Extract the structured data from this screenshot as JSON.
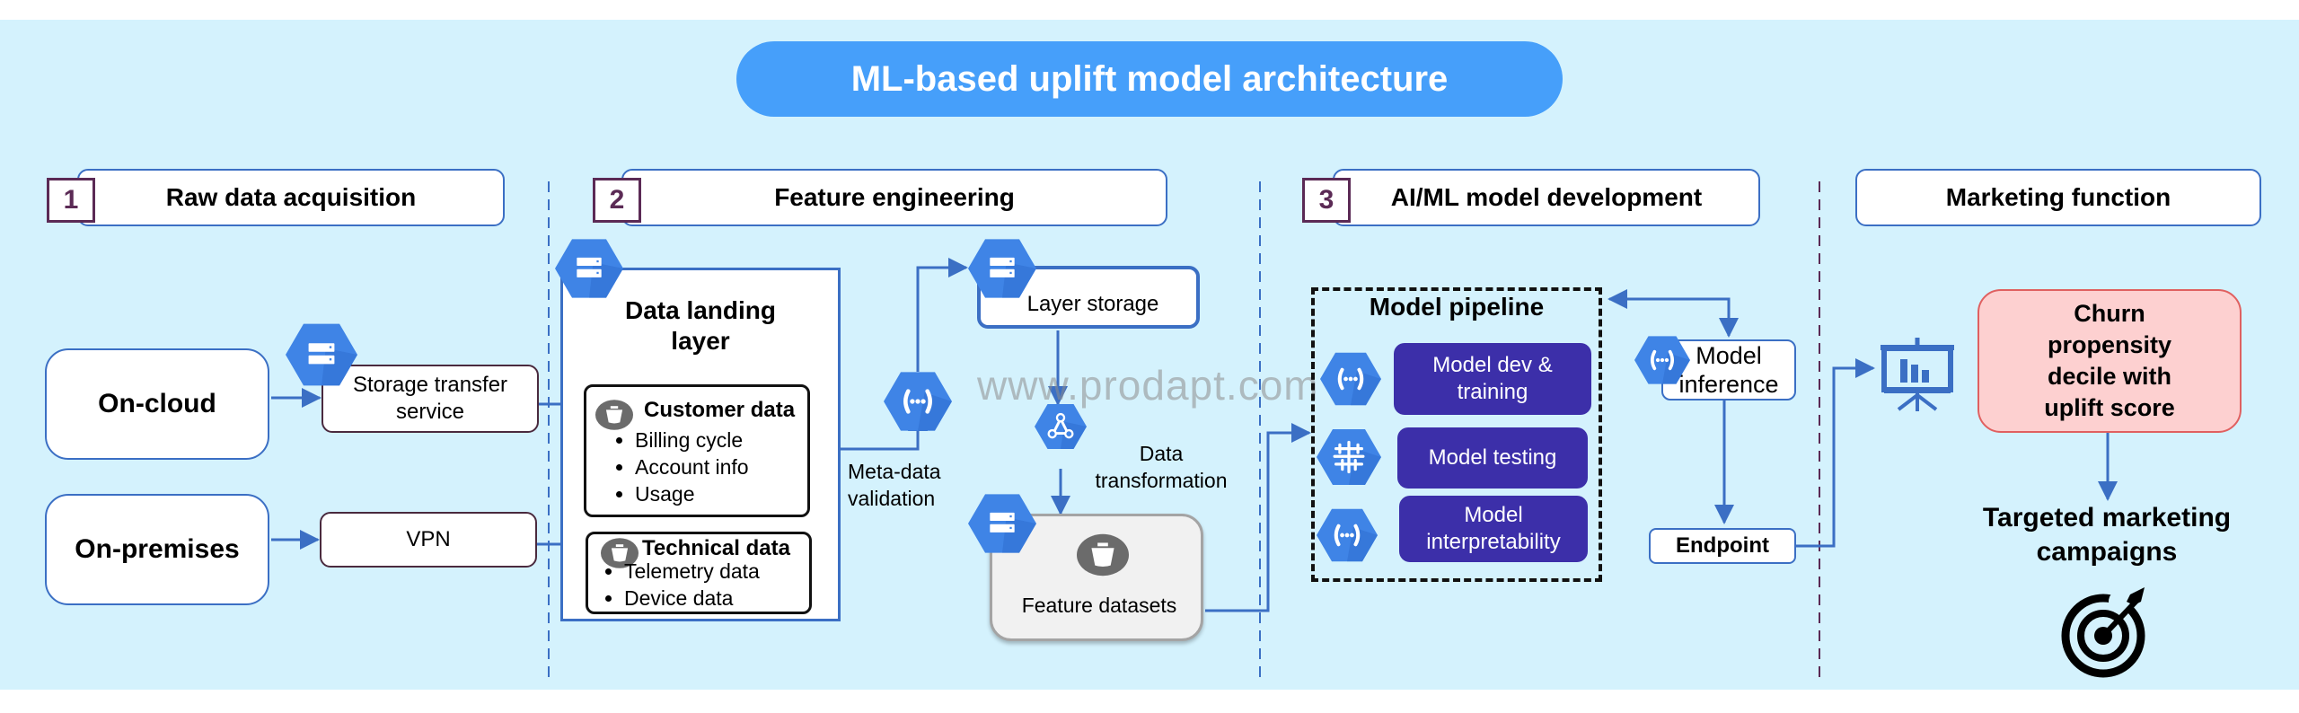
{
  "title": "ML-based uplift model architecture",
  "watermark": "www.prodapt.com",
  "colors": {
    "background": "#d4f2fd",
    "title_pill": "#469ffa",
    "connector_blue": "#3b6fc4",
    "badge_border": "#5b2a55",
    "hex_icon": "#3f84e6",
    "pipeline_step": "#3c2fa9",
    "churn_fill": "#fdd0d0",
    "churn_border": "#e06060"
  },
  "sections": [
    {
      "number": "1",
      "label": "Raw data acquisition"
    },
    {
      "number": "2",
      "label": "Feature engineering"
    },
    {
      "number": "3",
      "label": "AI/ML model development"
    },
    {
      "number": "",
      "label": "Marketing function"
    }
  ],
  "raw_data": {
    "sources": [
      {
        "label": "On-cloud",
        "icon": "cloud-storage-icon"
      },
      {
        "label": "On-premises"
      }
    ],
    "services": [
      {
        "label_line1": "Storage transfer",
        "label_line2": "service",
        "icon": "cloud-storage-icon"
      },
      {
        "label_line1": "VPN",
        "label_line2": ""
      }
    ]
  },
  "feature_engineering": {
    "landing_layer": {
      "title_line1": "Data landing",
      "title_line2": "layer",
      "icon": "cloud-storage-icon",
      "cards": [
        {
          "title": "Customer data",
          "icon": "basket-icon",
          "items": [
            "Billing cycle",
            "Account info",
            "Usage"
          ]
        },
        {
          "title": "Technical data",
          "icon": "basket-icon",
          "items": [
            "Telemetry data",
            "Device data"
          ]
        }
      ]
    },
    "metadata_validation": {
      "line1": "Meta-data",
      "line2": "validation",
      "icon": "cloud-functions-icon"
    },
    "layer_storage": {
      "label": "Layer storage",
      "icon": "cloud-storage-icon"
    },
    "data_transformation": {
      "line1": "Data",
      "line2": "transformation",
      "icon": "dataflow-icon"
    },
    "feature_datasets": {
      "label": "Feature datasets",
      "icon": "basket-icon"
    }
  },
  "model_dev": {
    "pipeline_title": "Model pipeline",
    "steps": [
      {
        "line1": "Model dev &",
        "line2": "training",
        "icon": "cloud-functions-icon"
      },
      {
        "line1": "Model testing",
        "line2": "",
        "icon": "ai-brain-icon"
      },
      {
        "line1": "Model",
        "line2": "interpretability",
        "icon": "cloud-functions-icon"
      }
    ],
    "inference": {
      "line1": "Model",
      "line2": "inference",
      "icon": "cloud-functions-icon"
    },
    "endpoint": "Endpoint"
  },
  "marketing": {
    "dashboard_icon": "presentation-chart-icon",
    "churn": {
      "line1": "Churn",
      "line2": "propensity",
      "line3": "decile with",
      "line4": "uplift score"
    },
    "targeted": {
      "line1": "Targeted marketing",
      "line2": "campaigns"
    },
    "target_icon": "target-arrow-icon"
  }
}
